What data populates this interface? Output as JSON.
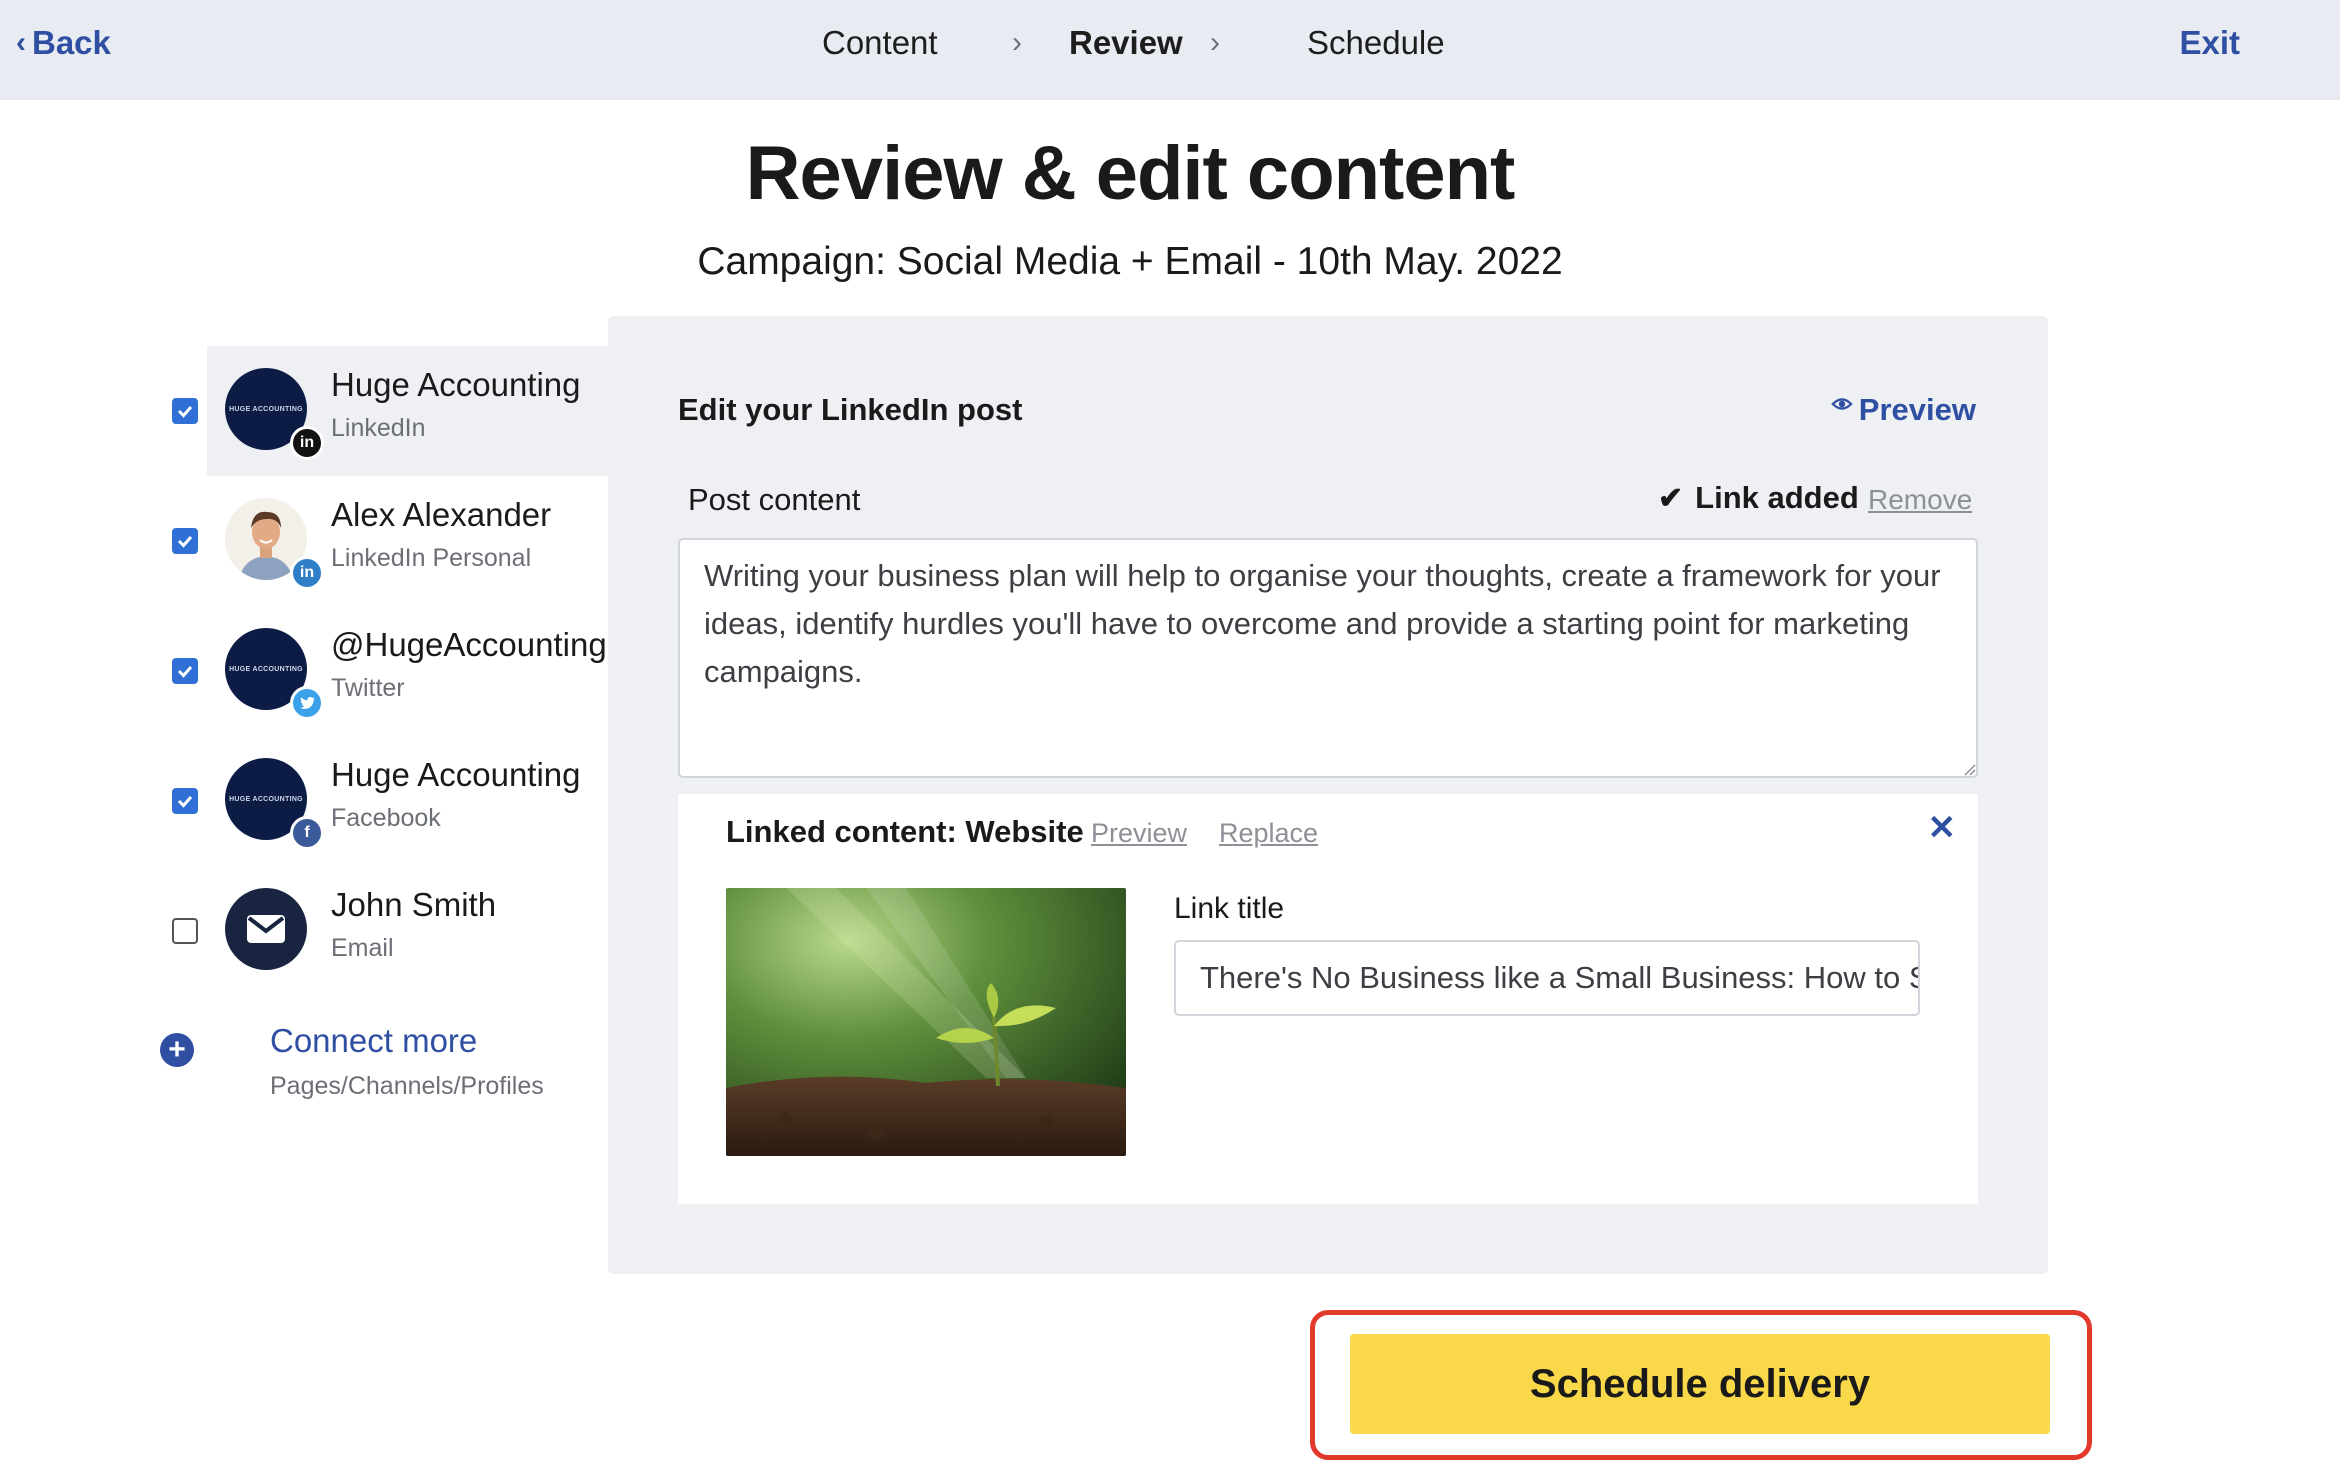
{
  "nav": {
    "back_label": "Back",
    "steps": [
      {
        "label": "Content",
        "active": false
      },
      {
        "label": "Review",
        "active": true
      },
      {
        "label": "Schedule",
        "active": false
      }
    ],
    "exit_label": "Exit"
  },
  "header": {
    "title": "Review & edit content",
    "campaign": "Campaign: Social Media + Email - 10th May. 2022"
  },
  "accounts": [
    {
      "name": "Huge Accounting",
      "network": "LinkedIn",
      "checked": true,
      "selected": true,
      "logo_text": "HUGE ACCOUNTING"
    },
    {
      "name": "Alex Alexander",
      "network": "LinkedIn Personal",
      "checked": true,
      "selected": false
    },
    {
      "name": "@HugeAccounting",
      "network": "Twitter",
      "checked": true,
      "selected": false,
      "logo_text": "HUGE ACCOUNTING"
    },
    {
      "name": "Huge Accounting",
      "network": "Facebook",
      "checked": true,
      "selected": false,
      "logo_text": "HUGE ACCOUNTING"
    },
    {
      "name": "John Smith",
      "network": "Email",
      "checked": false,
      "selected": false
    }
  ],
  "connect": {
    "label": "Connect more",
    "sub": "Pages/Channels/Profiles"
  },
  "editor": {
    "title": "Edit your LinkedIn post",
    "preview_label": "Preview",
    "post_content_label": "Post content",
    "link_added_label": "Link added",
    "remove_label": "Remove",
    "post_text": "Writing your business plan will help to organise your thoughts, create a framework for your ideas, identify hurdles you'll have to overcome and provide a starting point for marketing campaigns."
  },
  "linked_content": {
    "title": "Linked content: Website",
    "preview_label": "Preview",
    "replace_label": "Replace",
    "link_title_label": "Link title",
    "link_title_value": "There's No Business like a Small Business: How to S"
  },
  "cta": {
    "label": "Schedule delivery"
  },
  "colors": {
    "accent": "#2f4fa2",
    "cta": "#f9d949",
    "highlight": "#e23a2a",
    "checkbox": "#2f6fd6"
  }
}
